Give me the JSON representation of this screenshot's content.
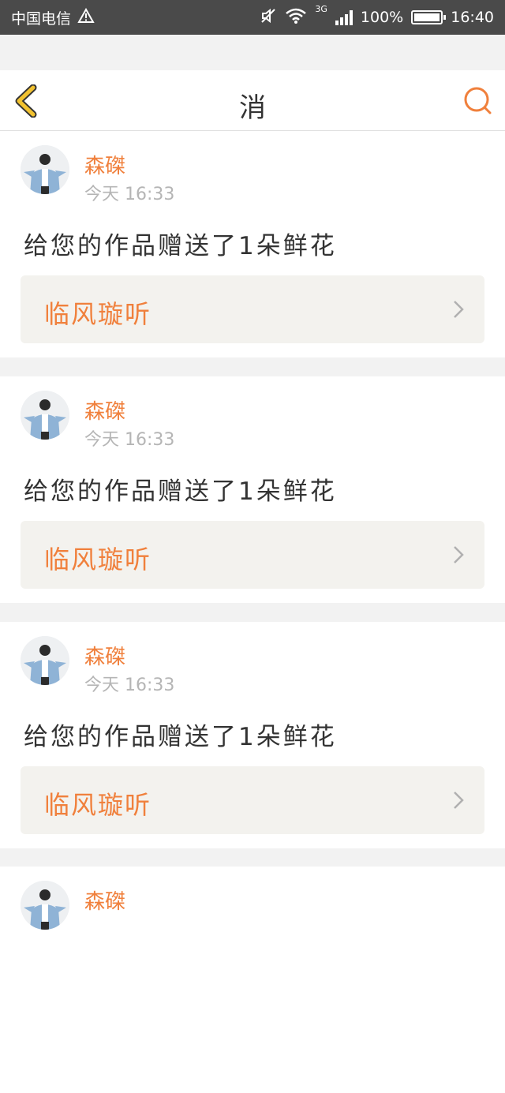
{
  "status_bar": {
    "carrier": "中国电信",
    "network": "3G",
    "battery": "100%",
    "time": "16:40"
  },
  "header": {
    "title": "消"
  },
  "messages": [
    {
      "user": "森磔",
      "time": "今天 16:33",
      "text": "给您的作品赠送了1朵鲜花",
      "work_title": "临风璇听"
    },
    {
      "user": "森磔",
      "time": "今天 16:33",
      "text": "给您的作品赠送了1朵鲜花",
      "work_title": "临风璇听"
    },
    {
      "user": "森磔",
      "time": "今天 16:33",
      "text": "给您的作品赠送了1朵鲜花",
      "work_title": "临风璇听"
    },
    {
      "user": "森磔",
      "time": "",
      "text": "",
      "work_title": ""
    }
  ],
  "colors": {
    "accent": "#f0803c",
    "back_arrow": "#f2c230",
    "status_bar_bg": "#4a4a4a"
  }
}
